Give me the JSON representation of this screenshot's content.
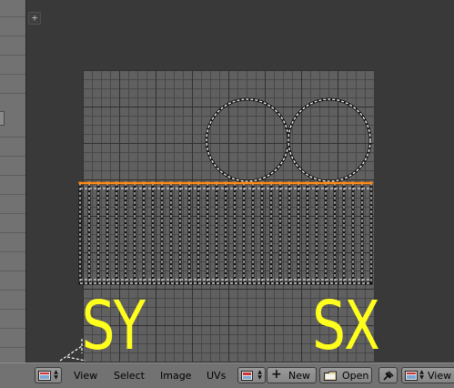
{
  "colors": {
    "background": "#393939",
    "image_bg": "#606060",
    "mesh_line": "#ffffff",
    "selected_edge": "#ff8c1a",
    "annotation": "#ffff1e",
    "header_bg": "#727272"
  },
  "annotations": {
    "left_label": "SY",
    "right_label": "SX"
  },
  "header": {
    "editor_type_icon": "image-editor-icon",
    "menus": [
      "View",
      "Select",
      "Image",
      "UVs"
    ],
    "image_browse_icon": "image-browse-icon",
    "new_label": "New",
    "new_icon": "plus-icon",
    "open_label": "Open",
    "open_icon": "folder-icon",
    "pin_icon": "pin-icon",
    "view_label": "View",
    "view_icon": "image-editor-icon"
  },
  "uv_mesh": {
    "circles": 2,
    "strip_columns": 32,
    "selected_edge": "top"
  }
}
